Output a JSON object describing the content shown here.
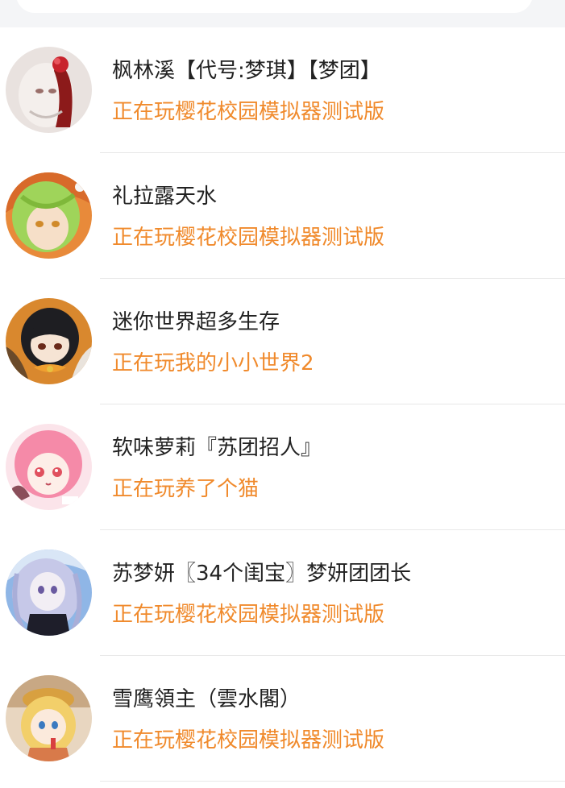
{
  "friends": [
    {
      "name": "枫林溪【代号:梦琪】【梦团】",
      "status": "正在玩樱花校园模拟器测试版",
      "avatar_icon": "anime-girl-red-flower-avatar"
    },
    {
      "name": "礼拉露天水",
      "status": "正在玩樱花校园模拟器测试版",
      "avatar_icon": "anime-green-hair-avatar"
    },
    {
      "name": "迷你世界超多生存",
      "status": "正在玩我的小小世界2",
      "avatar_icon": "anime-black-hair-orange-hood-avatar"
    },
    {
      "name": "软味萝莉『苏团招人』",
      "status": "正在玩养了个猫",
      "avatar_icon": "anime-pink-hair-avatar"
    },
    {
      "name": "苏梦妍〖34个闺宝〗梦妍团团长",
      "status": "正在玩樱花校园模拟器测试版",
      "avatar_icon": "anime-silver-hair-avatar"
    },
    {
      "name": "雪鹰領主（雲水閣）",
      "status": "正在玩樱花校园模拟器测试版",
      "avatar_icon": "anime-blonde-hat-avatar"
    }
  ],
  "colors": {
    "status_text": "#f08a2c",
    "name_text": "#222222",
    "divider": "#e8e8e8",
    "top_strip": "#f4f5f7"
  }
}
